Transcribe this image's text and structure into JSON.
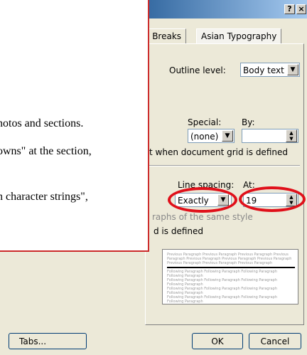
{
  "dialog": {
    "help_label": "?",
    "close_label": "×",
    "tabs": [
      "e Breaks",
      "Asian Typography"
    ]
  },
  "indent": {
    "outline_label": "Outline level:",
    "outline_value": "Body text",
    "special_label": "Special:",
    "special_value": "(none)",
    "by_label": "By:",
    "by_value": "",
    "grid_note": "t when document grid is defined"
  },
  "spacing": {
    "line_spacing_label": "Line spacing:",
    "line_spacing_value": "Exactly",
    "at_label": "At:",
    "at_value": "19",
    "same_style_note": "raphs of the same style",
    "grid_note": "d is defined"
  },
  "preview": {
    "previous_text": "Previous Paragraph Previous Paragraph Previous Paragraph Previous Paragraph Previous Paragraph Previous Paragraph Previous Paragraph Previous Paragraph Previous Paragraph Previous Paragraph",
    "following_text": "Following Paragraph Following Paragraph Following Paragraph Following Paragraph"
  },
  "buttons": {
    "tabs": "Tabs...",
    "ok": "OK",
    "cancel": "Cancel"
  },
  "document": {
    "line1": "notos and sections.",
    "line2": "owns\" at the section,",
    "line3": "h character strings\","
  },
  "colors": {
    "highlight_ring": "#e0101a",
    "callout_border": "#cc2b2b"
  }
}
